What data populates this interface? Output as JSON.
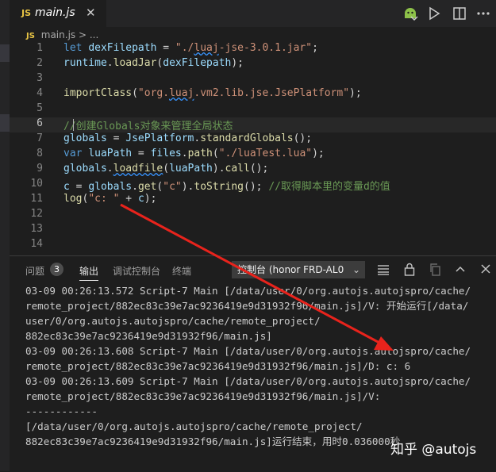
{
  "tab": {
    "lang_badge": "JS",
    "filename": "main.js",
    "close": "✕"
  },
  "breadcrumb": {
    "lang_badge": "JS",
    "path": "main.js > ..."
  },
  "toolbar": {
    "icons": [
      "android-run-icon",
      "play-icon",
      "split-editor-icon",
      "more-icon"
    ]
  },
  "editor": {
    "line_numbers": [
      "1",
      "2",
      "3",
      "4",
      "5",
      "6",
      "7",
      "8",
      "9",
      "10",
      "11",
      "12",
      "13",
      "14"
    ],
    "lines": [
      [
        {
          "t": "let",
          "c": "kw"
        },
        {
          "t": " ",
          "c": "pl"
        },
        {
          "t": "dexFilepath",
          "c": "var"
        },
        {
          "t": " = ",
          "c": "pl"
        },
        {
          "t": "\"./",
          "c": "str"
        },
        {
          "t": "luaj",
          "c": "str squig"
        },
        {
          "t": "-jse-3.0.1.jar\"",
          "c": "str"
        },
        {
          "t": ";",
          "c": "pl"
        }
      ],
      [
        {
          "t": "runtime",
          "c": "var"
        },
        {
          "t": ".",
          "c": "pl"
        },
        {
          "t": "loadJar",
          "c": "fn"
        },
        {
          "t": "(",
          "c": "pl"
        },
        {
          "t": "dexFilepath",
          "c": "var"
        },
        {
          "t": ");",
          "c": "pl"
        }
      ],
      [],
      [
        {
          "t": "importClass",
          "c": "fn"
        },
        {
          "t": "(",
          "c": "pl"
        },
        {
          "t": "\"org.",
          "c": "str"
        },
        {
          "t": "luaj",
          "c": "str squig"
        },
        {
          "t": ".vm2.lib.jse.JsePlatform\"",
          "c": "str"
        },
        {
          "t": ");",
          "c": "pl"
        }
      ],
      [],
      [
        {
          "t": "//创建Globals对象来管理全局状态",
          "c": "cmt"
        }
      ],
      [
        {
          "t": "globals",
          "c": "var"
        },
        {
          "t": " = ",
          "c": "pl"
        },
        {
          "t": "JsePlatform",
          "c": "var"
        },
        {
          "t": ".",
          "c": "pl"
        },
        {
          "t": "standardGlobals",
          "c": "fn"
        },
        {
          "t": "();",
          "c": "pl"
        }
      ],
      [
        {
          "t": "var",
          "c": "kw"
        },
        {
          "t": " ",
          "c": "pl"
        },
        {
          "t": "luaPath",
          "c": "var"
        },
        {
          "t": " = ",
          "c": "pl"
        },
        {
          "t": "files",
          "c": "var"
        },
        {
          "t": ".",
          "c": "pl"
        },
        {
          "t": "path",
          "c": "fn"
        },
        {
          "t": "(",
          "c": "pl"
        },
        {
          "t": "\"./luaTest.lua\"",
          "c": "str"
        },
        {
          "t": ");",
          "c": "pl"
        }
      ],
      [
        {
          "t": "globals",
          "c": "var"
        },
        {
          "t": ".",
          "c": "pl"
        },
        {
          "t": "loadfile",
          "c": "fn squig"
        },
        {
          "t": "(",
          "c": "pl"
        },
        {
          "t": "luaPath",
          "c": "var"
        },
        {
          "t": ").",
          "c": "pl"
        },
        {
          "t": "call",
          "c": "fn"
        },
        {
          "t": "();",
          "c": "pl"
        }
      ],
      [
        {
          "t": "c",
          "c": "var"
        },
        {
          "t": " = ",
          "c": "pl"
        },
        {
          "t": "globals",
          "c": "var"
        },
        {
          "t": ".",
          "c": "pl"
        },
        {
          "t": "get",
          "c": "fn"
        },
        {
          "t": "(",
          "c": "pl"
        },
        {
          "t": "\"c\"",
          "c": "str"
        },
        {
          "t": ").",
          "c": "pl"
        },
        {
          "t": "toString",
          "c": "fn"
        },
        {
          "t": "(); ",
          "c": "pl"
        },
        {
          "t": "//取得脚本里的变量d的值",
          "c": "cmt"
        }
      ],
      [
        {
          "t": "log",
          "c": "fn"
        },
        {
          "t": "(",
          "c": "pl"
        },
        {
          "t": "\"c: \"",
          "c": "str"
        },
        {
          "t": " + ",
          "c": "pl"
        },
        {
          "t": "c",
          "c": "var"
        },
        {
          "t": ");",
          "c": "pl"
        }
      ],
      [],
      [],
      []
    ]
  },
  "panel": {
    "tabs": [
      "问题",
      "输出",
      "调试控制台",
      "终端"
    ],
    "problems_count": "3",
    "channel": "控制台 (honor FRD-AL0",
    "icons": [
      "filter-lines-icon",
      "lock-icon",
      "copy-icon",
      "chevron-up-icon",
      "close-icon"
    ],
    "output": [
      "03-09 00:26:13.572 Script-7 Main [/data/user/0/org.autojs.autojspro/cache/",
      "remote_project/882ec83c39e7ac9236419e9d31932f96/main.js]/V: 开始运行[/data/",
      "user/0/org.autojs.autojspro/cache/remote_project/",
      "882ec83c39e7ac9236419e9d31932f96/main.js]",
      "03-09 00:26:13.608 Script-7 Main [/data/user/0/org.autojs.autojspro/cache/",
      "remote_project/882ec83c39e7ac9236419e9d31932f96/main.js]/D: c: 6",
      "03-09 00:26:13.609 Script-7 Main [/data/user/0/org.autojs.autojspro/cache/",
      "remote_project/882ec83c39e7ac9236419e9d31932f96/main.js]/V:",
      "------------",
      "[/data/user/0/org.autojs.autojspro/cache/remote_project/",
      "882ec83c39e7ac9236419e9d31932f96/main.js]运行结束，用时0.036000秒"
    ]
  },
  "watermark": "知乎 @autojs",
  "colors": {
    "arrow": "#e8231c",
    "background": "#1e1e1e"
  }
}
